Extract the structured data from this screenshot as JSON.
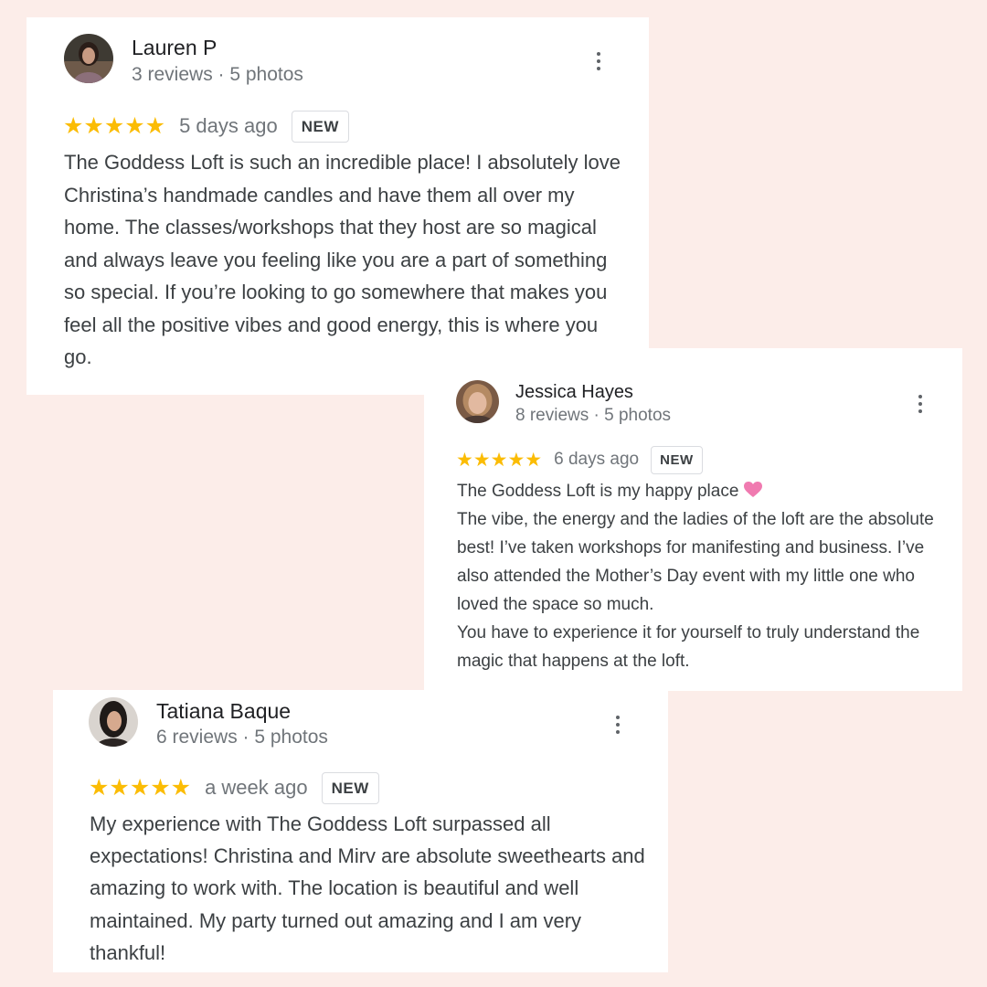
{
  "colors": {
    "background": "#fcede9",
    "card": "#ffffff",
    "star": "#fbbc04",
    "badge_border": "#dadce0",
    "heart": "#f07ab0"
  },
  "reviews": [
    {
      "reviewer": "Lauren P",
      "meta": "3 reviews · 5 photos",
      "stars": "★★★★★",
      "rating": 5,
      "date": "5 days ago",
      "badge": "NEW",
      "paragraphs": [
        "The Goddess Loft is such an incredible place! I absolutely love Christina’s handmade candles and have them all over my home. The classes/workshops that they host are so magical and always leave you feeling like you are a part of something so special. If you’re looking to go somewhere that makes you feel all the positive vibes and good energy, this is where you go."
      ]
    },
    {
      "reviewer": "Jessica Hayes",
      "meta": "8 reviews · 5 photos",
      "stars": "★★★★★",
      "rating": 5,
      "date": "6 days ago",
      "badge": "NEW",
      "paragraphs": [
        "The Goddess Loft is my happy place",
        "The vibe, the energy and the ladies of the loft are the absolute best! I’ve taken workshops for manifesting and business. I’ve also attended the Mother’s Day event with my little one who loved the space so much.",
        "You have to experience it for yourself to truly understand the magic that happens at the loft."
      ],
      "emoji": "pink-heart-icon"
    },
    {
      "reviewer": "Tatiana Baque",
      "meta": "6 reviews · 5 photos",
      "stars": "★★★★★",
      "rating": 5,
      "date": "a week ago",
      "badge": "NEW",
      "paragraphs": [
        "My experience with The Goddess Loft surpassed all expectations! Christina and Mirv are absolute sweethearts and amazing to work with. The location is beautiful and well maintained. My party turned out amazing and I am very thankful!"
      ]
    }
  ]
}
